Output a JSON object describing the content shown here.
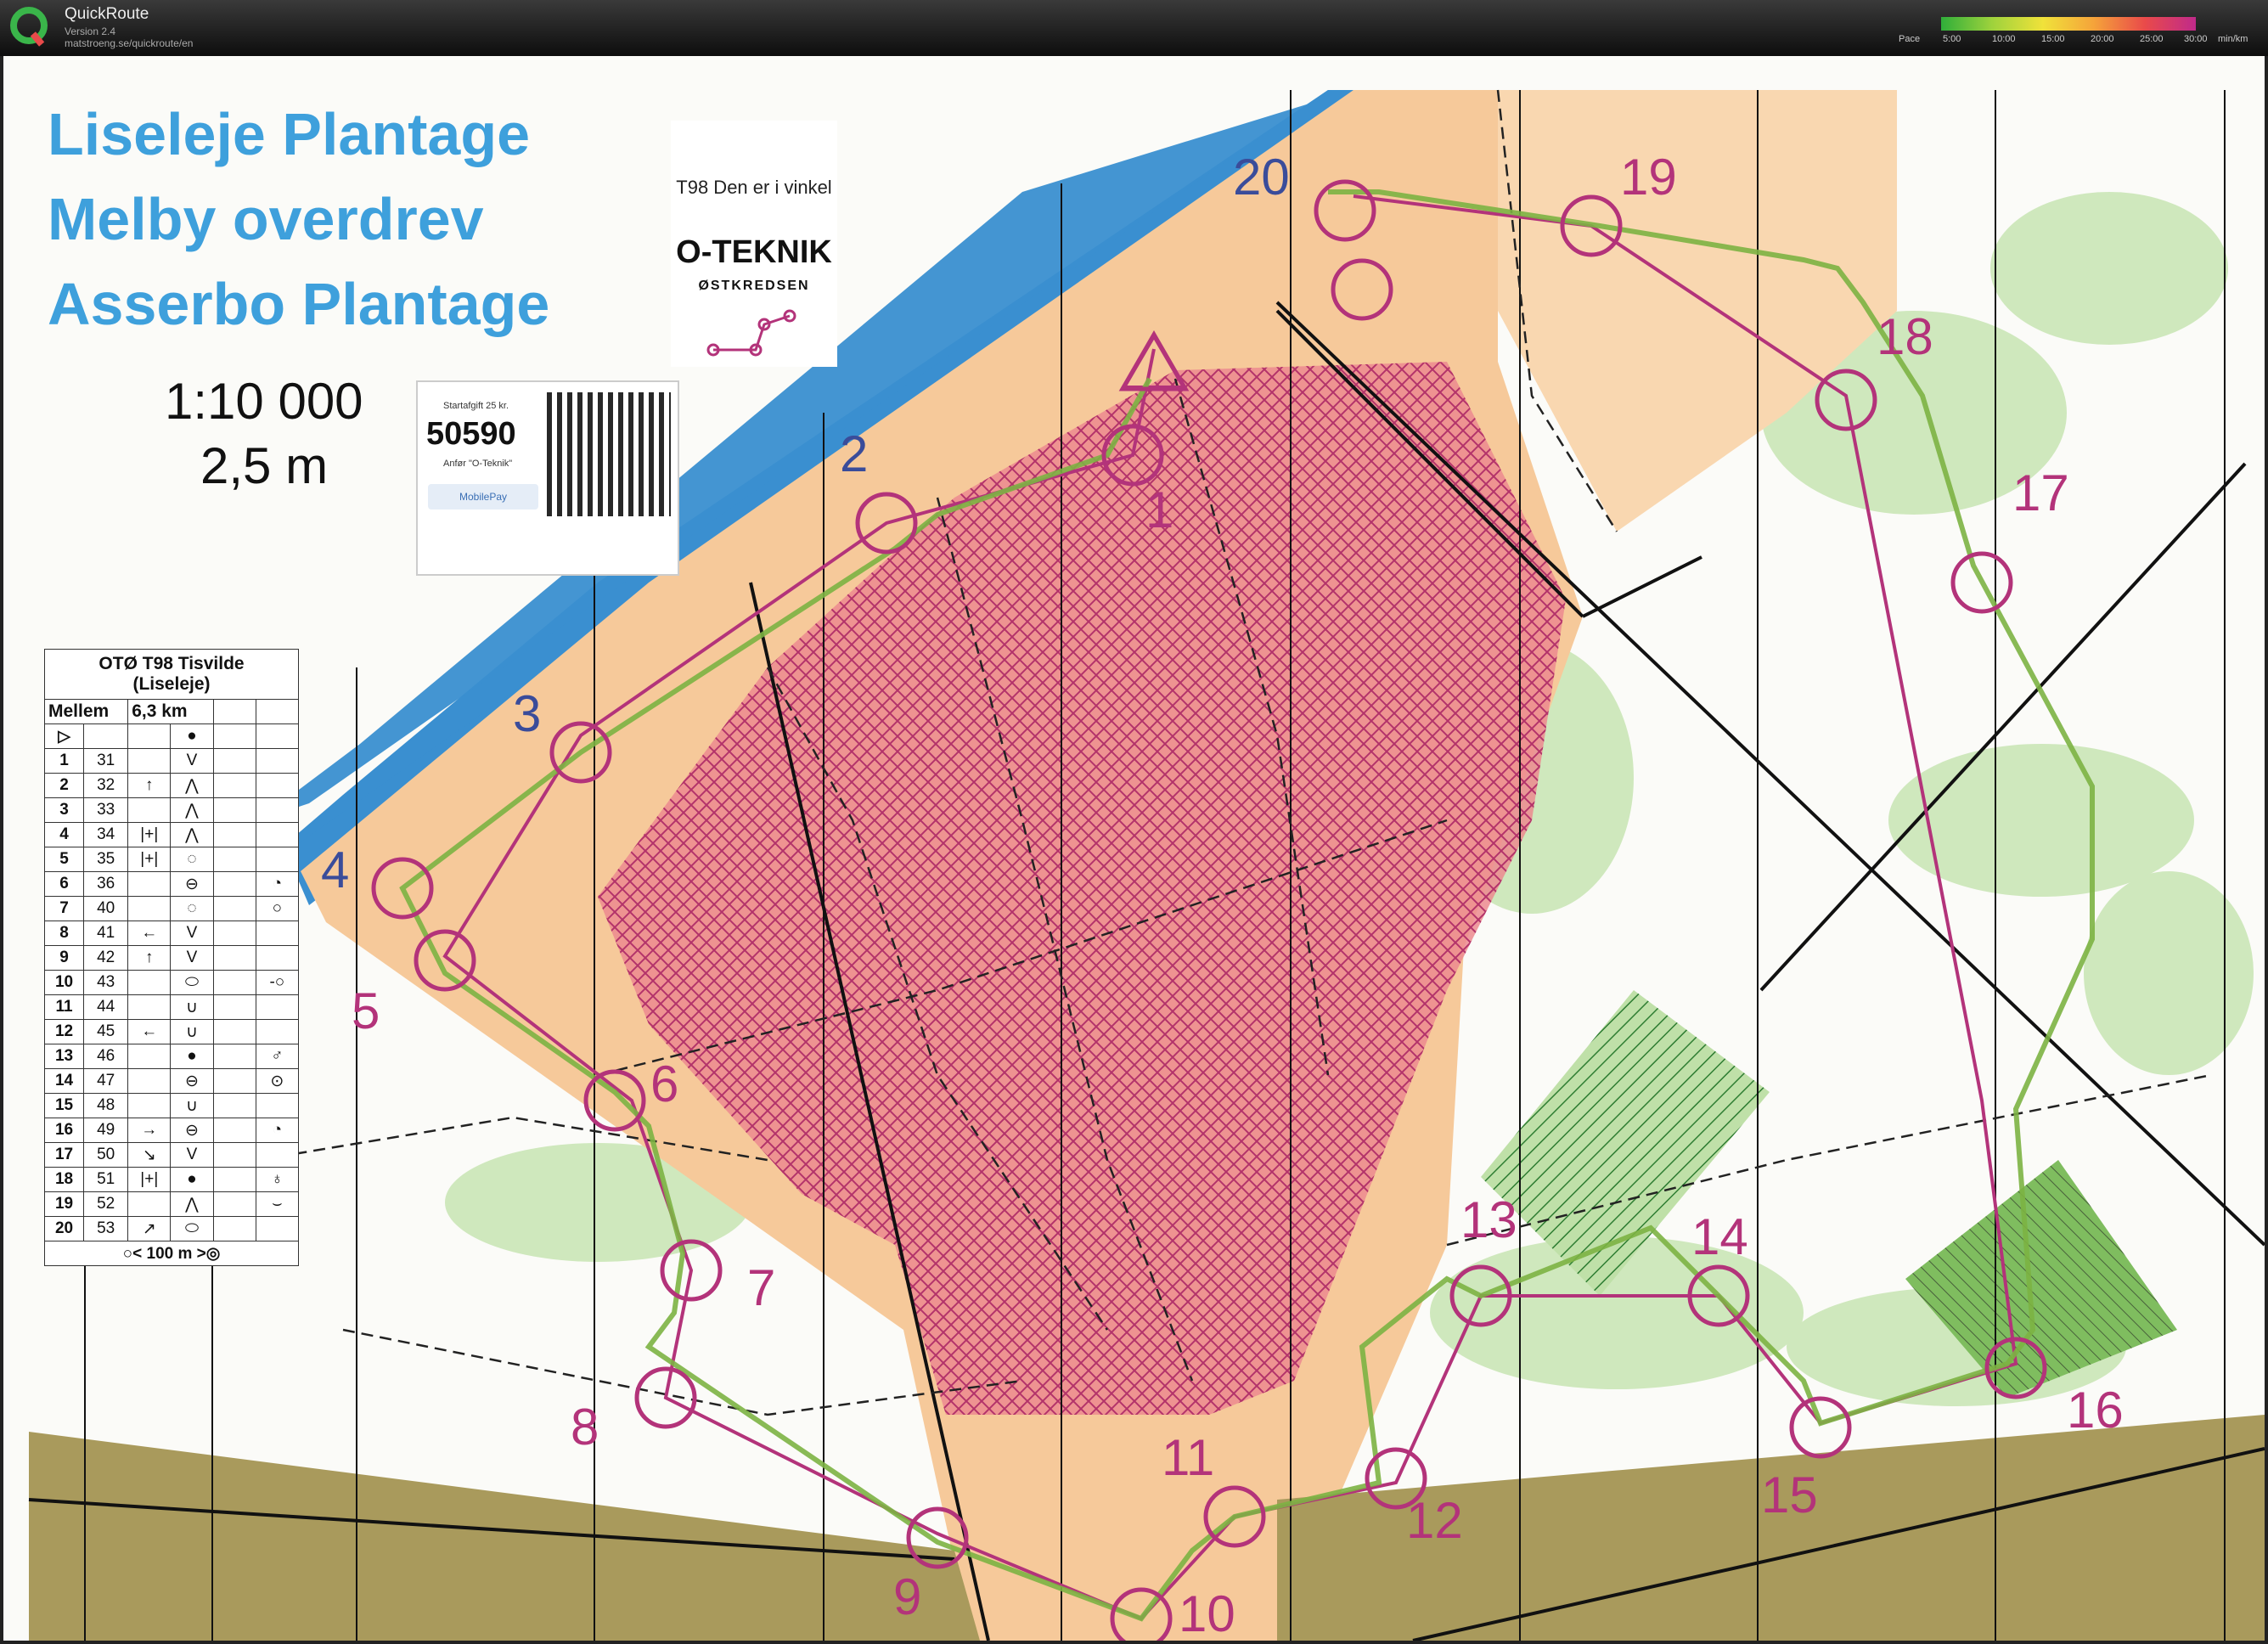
{
  "window": {
    "app_name": "QuickRoute",
    "version": "Version 2.4",
    "url": "matstroeng.se/quickroute/en"
  },
  "pace_legend": {
    "label": "Pace",
    "ticks": [
      "5:00",
      "10:00",
      "15:00",
      "20:00",
      "25:00",
      "30:00"
    ],
    "unit": "min/km"
  },
  "map": {
    "titles": [
      "Liseleje Plantage",
      "Melby overdrev",
      "Asserbo Plantage"
    ],
    "scale": "1:10 000",
    "contour_interval": "2,5 m",
    "event_tag": "T98 Den er i vinkel",
    "event_org": "O-TEKNIK",
    "event_sub": "ØSTKREDSEN",
    "payment": {
      "fee": "Startafgift 25 kr.",
      "number": "50590",
      "note": "Anfør \"O-Teknik\"",
      "provider": "MobilePay"
    },
    "description": {
      "title_line1": "OTØ T98 Tisvilde",
      "title_line2": "(Liseleje)",
      "class": "Mellem",
      "length": "6,3 km",
      "start_symbol": "▷",
      "start_feature": "●",
      "rows": [
        {
          "n": "1",
          "code": "31",
          "dir": "",
          "feat": "V",
          "extra": ""
        },
        {
          "n": "2",
          "code": "32",
          "dir": "↑",
          "feat": "⋀",
          "extra": ""
        },
        {
          "n": "3",
          "code": "33",
          "dir": "",
          "feat": "⋀",
          "extra": ""
        },
        {
          "n": "4",
          "code": "34",
          "dir": "|+|",
          "feat": "⋀",
          "extra": ""
        },
        {
          "n": "5",
          "code": "35",
          "dir": "|+|",
          "feat": "◌",
          "extra": ""
        },
        {
          "n": "6",
          "code": "36",
          "dir": "",
          "feat": "⊖",
          "extra": "◔"
        },
        {
          "n": "7",
          "code": "40",
          "dir": "",
          "feat": "◌",
          "extra": "○"
        },
        {
          "n": "8",
          "code": "41",
          "dir": "←",
          "feat": "V",
          "extra": ""
        },
        {
          "n": "9",
          "code": "42",
          "dir": "↑",
          "feat": "V",
          "extra": ""
        },
        {
          "n": "10",
          "code": "43",
          "dir": "",
          "feat": "⬭",
          "extra": "-○"
        },
        {
          "n": "11",
          "code": "44",
          "dir": "",
          "feat": "∪",
          "extra": ""
        },
        {
          "n": "12",
          "code": "45",
          "dir": "←",
          "feat": "∪",
          "extra": ""
        },
        {
          "n": "13",
          "code": "46",
          "dir": "",
          "feat": "●",
          "extra": "♂"
        },
        {
          "n": "14",
          "code": "47",
          "dir": "",
          "feat": "⊖",
          "extra": "⊙"
        },
        {
          "n": "15",
          "code": "48",
          "dir": "",
          "feat": "∪",
          "extra": ""
        },
        {
          "n": "16",
          "code": "49",
          "dir": "→",
          "feat": "⊖",
          "extra": "◔"
        },
        {
          "n": "17",
          "code": "50",
          "dir": "↘",
          "feat": "V",
          "extra": ""
        },
        {
          "n": "18",
          "code": "51",
          "dir": "|+|",
          "feat": "●",
          "extra": "♁"
        },
        {
          "n": "19",
          "code": "52",
          "dir": "",
          "feat": "⋀",
          "extra": "⌣"
        },
        {
          "n": "20",
          "code": "53",
          "dir": "↗",
          "feat": "⬭",
          "extra": ""
        }
      ],
      "finish": "○< 100 m >◎"
    },
    "controls": [
      {
        "n": "1"
      },
      {
        "n": "2"
      },
      {
        "n": "3"
      },
      {
        "n": "4"
      },
      {
        "n": "5"
      },
      {
        "n": "6"
      },
      {
        "n": "7"
      },
      {
        "n": "8"
      },
      {
        "n": "9"
      },
      {
        "n": "10"
      },
      {
        "n": "11"
      },
      {
        "n": "12"
      },
      {
        "n": "13"
      },
      {
        "n": "14"
      },
      {
        "n": "15"
      },
      {
        "n": "16"
      },
      {
        "n": "17"
      },
      {
        "n": "18"
      },
      {
        "n": "19"
      },
      {
        "n": "20"
      }
    ]
  },
  "colors": {
    "course": "#b3337a",
    "route": "#7cb342",
    "sea": "#3a8fd0",
    "forbidden": "#e8707a",
    "open_land": "#f6c99a",
    "urban": "#9c8a4a",
    "green": "#bfe0a8"
  }
}
